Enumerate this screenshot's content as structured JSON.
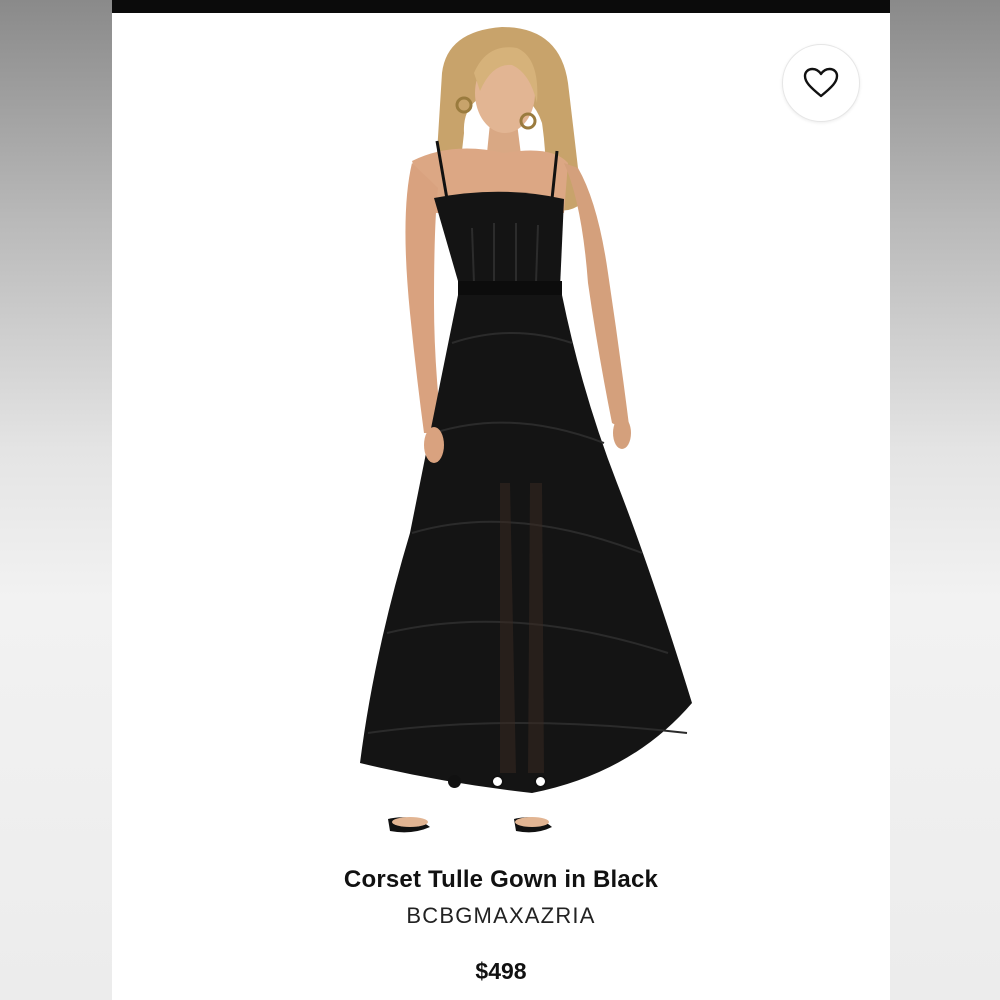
{
  "product": {
    "title": "Corset Tulle Gown in Black",
    "brand": "BCBGMAXAZRIA",
    "price": "$498"
  },
  "gallery": {
    "slide_count": 3,
    "active_index": 0
  },
  "icons": {
    "favorite": "heart-outline-icon"
  },
  "colors": {
    "top_bar": "#0b0b0b",
    "text": "#111111",
    "dress": "#141414"
  }
}
